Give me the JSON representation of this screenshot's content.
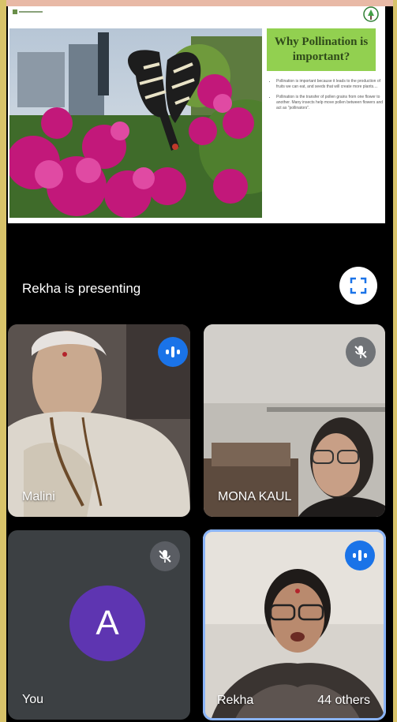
{
  "slide": {
    "title": "Why Pollination is important?",
    "bullets": [
      "Pollination is important because it leads to the production of fruits we can eat, and seeds that will create more plants....",
      "Pollination is the transfer of pollen grains from one flower to another. Many insects help move pollen between flowers and act as \"pollinators\"."
    ]
  },
  "presentation": {
    "presenting_label": "Rekha is presenting"
  },
  "participants": {
    "malini": {
      "name": "Malini"
    },
    "mona": {
      "name": "MONA KAUL"
    },
    "you": {
      "name": "You",
      "avatar_letter": "A"
    },
    "rekha": {
      "name": "Rekha",
      "others_label": "44 others"
    }
  },
  "colors": {
    "accent_blue": "#1a73e8",
    "avatar_purple": "#5e35b1",
    "slide_title_bg": "#92d050",
    "tile_bg": "#3c4043"
  },
  "icons": {
    "fullscreen": "fullscreen-icon",
    "speaking": "audio-wave-icon",
    "muted": "mic-off-icon"
  }
}
